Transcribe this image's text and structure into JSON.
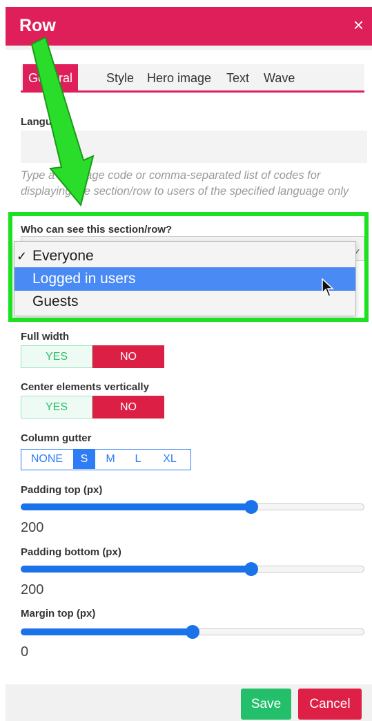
{
  "dialog": {
    "title": "Row",
    "close_glyph": "×"
  },
  "tabs": [
    {
      "label": "General",
      "active": true
    },
    {
      "label": "Style"
    },
    {
      "label": "Hero image"
    },
    {
      "label": "Text"
    },
    {
      "label": "Wave"
    }
  ],
  "language": {
    "label": "Language",
    "value": "",
    "hint": "Type a language code or comma-separated list of codes for displaying the section/row to users of the specified language only"
  },
  "visibility": {
    "label": "Who can see this section/row?",
    "options": [
      {
        "label": "Everyone",
        "checked": true
      },
      {
        "label": "Logged in users",
        "highlighted": true
      },
      {
        "label": "Guests"
      }
    ]
  },
  "full_width": {
    "label": "Full width",
    "yes": "YES",
    "no": "NO",
    "value": "NO"
  },
  "center_vertically": {
    "label": "Center elements vertically",
    "yes": "YES",
    "no": "NO",
    "value": "NO"
  },
  "column_gutter": {
    "label": "Column gutter",
    "options": [
      "NONE",
      "S",
      "M",
      "L",
      "XL"
    ],
    "selected": "S"
  },
  "padding_top": {
    "label": "Padding top (px)",
    "value": "200",
    "fraction": 0.67
  },
  "padding_bottom": {
    "label": "Padding bottom (px)",
    "value": "200",
    "fraction": 0.67
  },
  "margin_top": {
    "label": "Margin top (px)",
    "value": "0",
    "fraction": 0.5
  },
  "footer": {
    "save_label": "Save",
    "cancel_label": "Cancel"
  },
  "colors": {
    "header": "#df1f5a",
    "highlight_frame": "#1be21f",
    "selected_option": "#4a8af4",
    "accent_blue": "#1a73e8",
    "save": "#24bf6a",
    "cancel": "#de1f46"
  },
  "icons": {
    "close": "close-icon",
    "cursor": "mouse-pointer-icon",
    "annotation": "arrow-down-annotation"
  }
}
